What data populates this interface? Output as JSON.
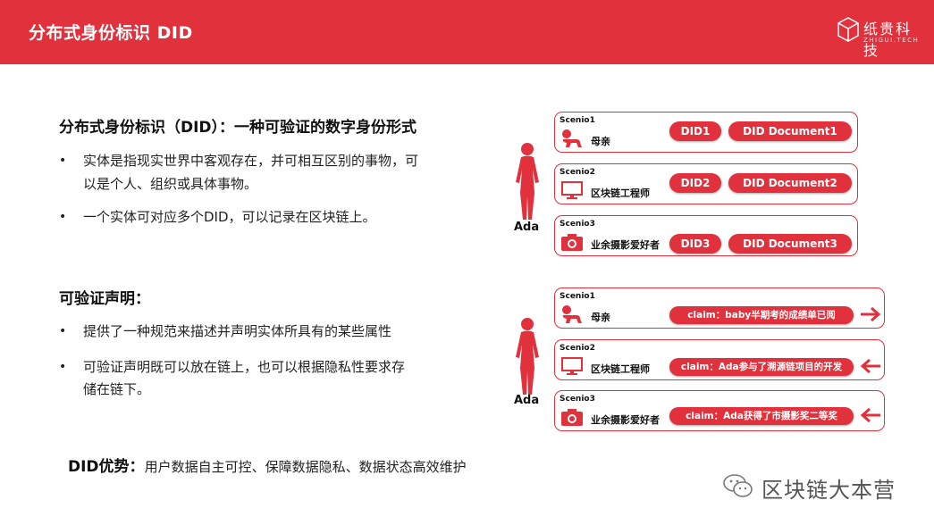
{
  "header": {
    "title": "分布式身份标识 DID",
    "logo_text": "纸贵科技",
    "logo_sub": "ZHIGUI.TECH"
  },
  "section1": {
    "title": "分布式身份标识（DID）：一种可验证的数字身份形式",
    "bullets": [
      "实体是指现实世界中客观存在，并可相互区别的事物，可",
      "以是个人、组织或具体事物。",
      "一个实体可对应多个DID，可以记录在区块链上。"
    ]
  },
  "section2": {
    "title": "可验证声明：",
    "bullets": [
      "提供了一种规范来描述并声明实体所具有的某些属性",
      "可验证声明既可以放在链上，也可以根据隐私性要求存",
      "储在链下。"
    ]
  },
  "advantage": {
    "label": "DID优势：",
    "text": "用户数据自主可控、保障数据隐私、数据状态高效维护"
  },
  "diagram1": {
    "person": "Ada",
    "scenes": [
      {
        "label": "Scenio1",
        "role": "母亲",
        "icon": "baby-icon",
        "did": "DID1",
        "doc": "DID Document1"
      },
      {
        "label": "Scenio2",
        "role": "区块链工程师",
        "icon": "monitor-icon",
        "did": "DID2",
        "doc": "DID Document2"
      },
      {
        "label": "Scenio3",
        "role": "业余摄影爱好者",
        "icon": "camera-icon",
        "did": "DID3",
        "doc": "DID Document3"
      }
    ]
  },
  "diagram2": {
    "person": "Ada",
    "scenes": [
      {
        "label": "Scenio1",
        "role": "母亲",
        "icon": "baby-icon",
        "claim": "claim：baby半期考的成绩单已阅",
        "arrow": "right"
      },
      {
        "label": "Scenio2",
        "role": "区块链工程师",
        "icon": "monitor-icon",
        "claim": "claim：Ada参与了溯源链项目的开发",
        "arrow": "left"
      },
      {
        "label": "Scenio3",
        "role": "业余摄影爱好者",
        "icon": "camera-icon",
        "claim": "claim：Ada获得了市摄影奖二等奖",
        "arrow": "left"
      }
    ]
  },
  "watermark": {
    "text": "区块链大本营"
  },
  "colors": {
    "accent": "#e0313c",
    "text": "#222222"
  }
}
